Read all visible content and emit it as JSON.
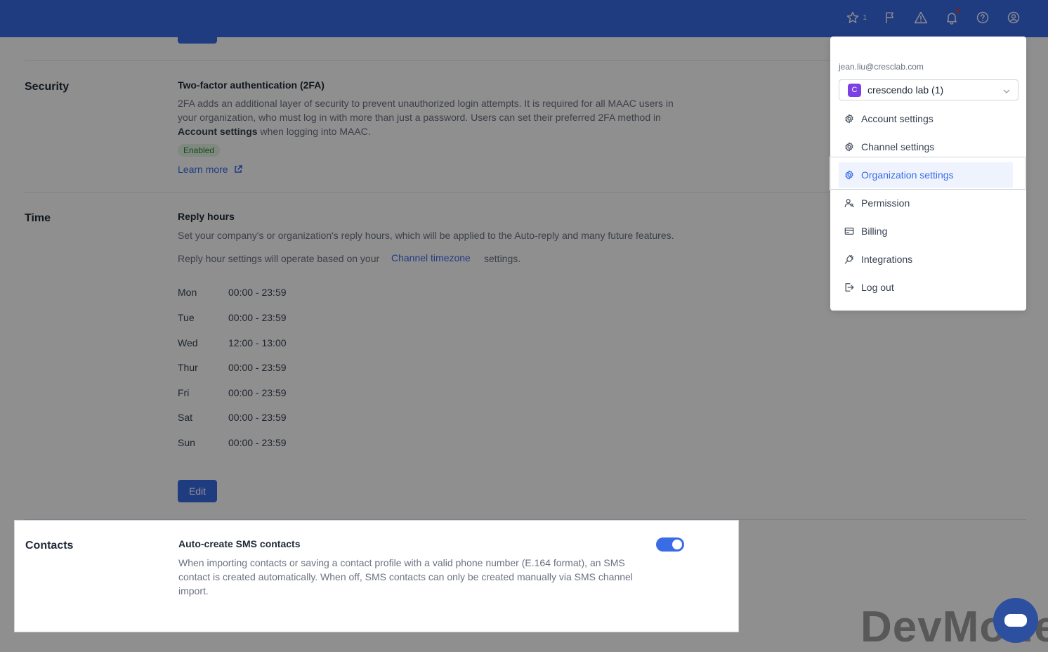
{
  "topbar": {
    "favorites_count": "1",
    "icons": [
      "star-icon",
      "flag-icon",
      "warning-icon",
      "bell-icon",
      "help-icon",
      "user-icon"
    ]
  },
  "security": {
    "title": "Security",
    "subtitle": "Two-factor authentication (2FA)",
    "desc_1": "2FA adds an additional layer of security to prevent unauthorized login attempts. It is required for all MAAC users in",
    "desc_2": "your organization, who must log in with more than just a password. Users can set their preferred 2FA method in",
    "desc_3_bold": "Account settings",
    "desc_3_rest": " when logging into MAAC.",
    "badge": "Enabled",
    "learn_more": "Learn more"
  },
  "time": {
    "title": "Time",
    "subtitle": "Reply hours",
    "desc": "Set your company's or organization's reply hours, which will be applied to the Auto-reply and many future features.",
    "tz_prefix": "Reply hour settings will operate based on your",
    "tz_link": "Channel timezone",
    "tz_suffix": "settings.",
    "days": [
      {
        "day": "Mon",
        "hours": "00:00 - 23:59"
      },
      {
        "day": "Tue",
        "hours": "00:00 - 23:59"
      },
      {
        "day": "Wed",
        "hours": "12:00 - 13:00"
      },
      {
        "day": "Thur",
        "hours": "00:00 - 23:59"
      },
      {
        "day": "Fri",
        "hours": "00:00 - 23:59"
      },
      {
        "day": "Sat",
        "hours": "00:00 - 23:59"
      },
      {
        "day": "Sun",
        "hours": "00:00 - 23:59"
      }
    ],
    "edit_label": "Edit"
  },
  "contacts": {
    "title": "Contacts",
    "subtitle": "Auto-create SMS contacts",
    "desc_1": "When importing contacts or saving a contact profile with a valid phone number (E.164 format), an SMS",
    "desc_2": "contact is created automatically. When off, SMS contacts can only be created manually via SMS channel",
    "desc_3": "import.",
    "toggle_on": true
  },
  "menu": {
    "email": "jean.liu@cresclab.com",
    "org_initial": "C",
    "org_name": "crescendo lab (1)",
    "items": [
      {
        "label": "Account settings",
        "icon": "gear-icon"
      },
      {
        "label": "Channel settings",
        "icon": "gear-icon"
      },
      {
        "label": "Organization settings",
        "icon": "gear-icon"
      },
      {
        "label": "Permission",
        "icon": "person-key-icon"
      },
      {
        "label": "Billing",
        "icon": "card-icon"
      },
      {
        "label": "Integrations",
        "icon": "plug-icon"
      },
      {
        "label": "Log out",
        "icon": "logout-icon"
      }
    ],
    "active_item": "Organization settings"
  },
  "watermark": "DevMode",
  "colors": {
    "accent": "#3a6ce6",
    "org_avatar": "#7b3fe4",
    "badge_green": "#2e7d32"
  }
}
